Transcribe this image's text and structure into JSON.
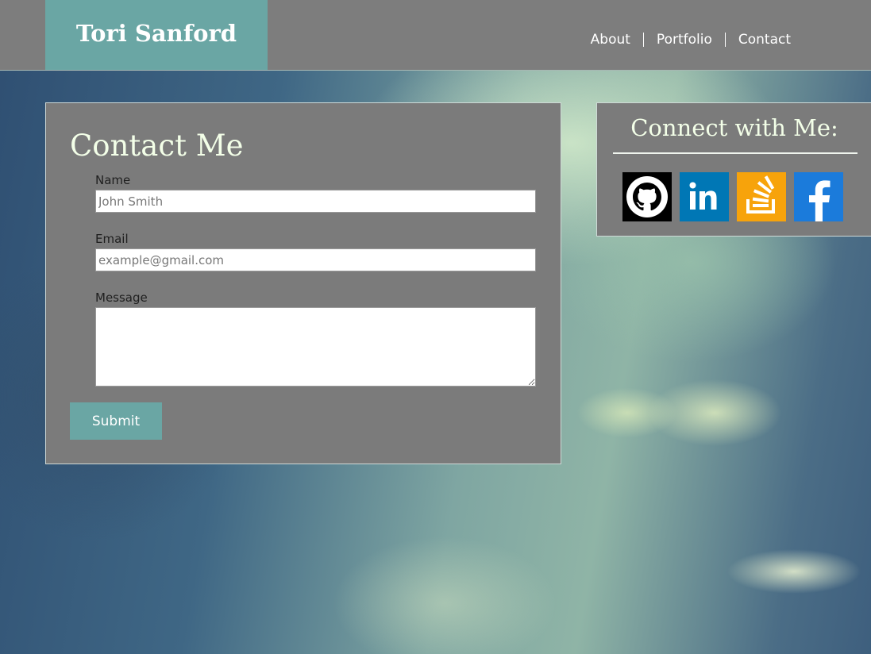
{
  "header": {
    "brand": "Tori Sanford",
    "nav": [
      {
        "label": "About"
      },
      {
        "label": "Portfolio"
      },
      {
        "label": "Contact"
      }
    ]
  },
  "contact_form": {
    "title": "Contact Me",
    "name_label": "Name",
    "name_placeholder": "John Smith",
    "email_label": "Email",
    "email_placeholder": "example@gmail.com",
    "message_label": "Message",
    "message_value": "",
    "submit_label": "Submit"
  },
  "connect": {
    "title": "Connect with Me:",
    "icons": [
      {
        "name": "github-icon",
        "color": "#000000"
      },
      {
        "name": "linkedin-icon",
        "color": "#0077b5"
      },
      {
        "name": "stackoverflow-icon",
        "color": "#f48024"
      },
      {
        "name": "facebook-icon",
        "color": "#1877f2"
      }
    ]
  },
  "colors": {
    "accent": "#6aa6a4",
    "panel": "#7b7b7b",
    "heading": "#f3ffe8"
  }
}
